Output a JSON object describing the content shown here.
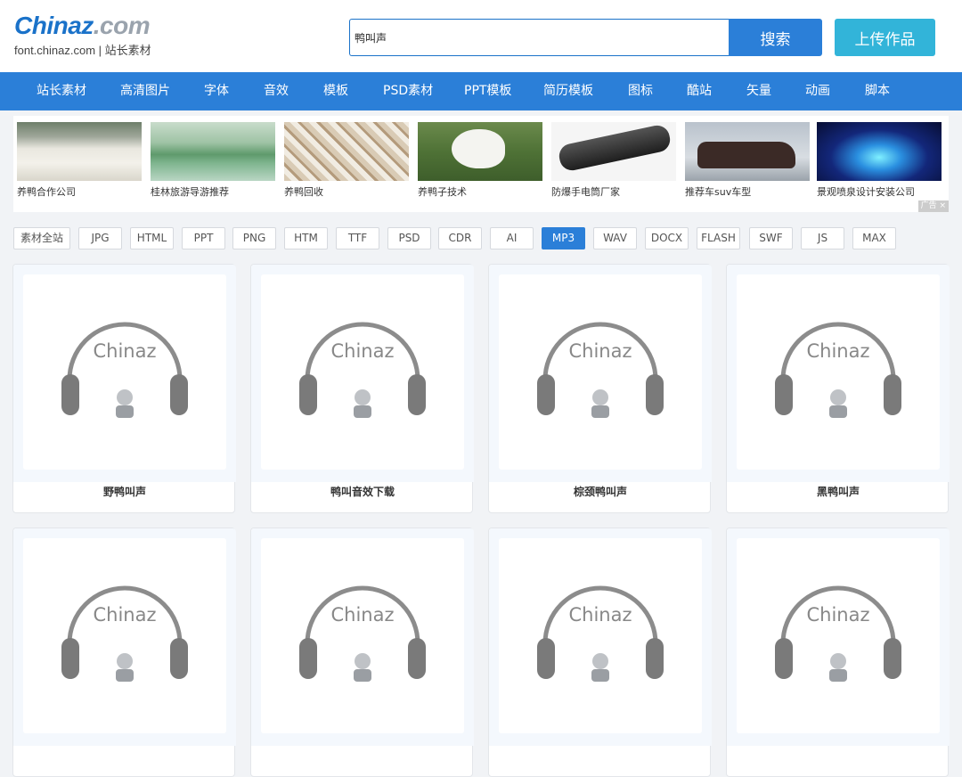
{
  "logo": {
    "main_a": "Chinaz",
    "main_b": ".com",
    "sub": "font.chinaz.com | 站长素材"
  },
  "search": {
    "value": "鸭叫声",
    "button": "搜索"
  },
  "upload_button": "上传作品",
  "nav": [
    "站长素材",
    "高清图片",
    "字体",
    "音效",
    "模板",
    "PSD素材",
    "PPT模板",
    "简历模板",
    "图标",
    "酷站",
    "矢量",
    "动画",
    "脚本"
  ],
  "ads": {
    "items": [
      "养鸭合作公司",
      "桂林旅游导游推荐",
      "养鸭回收",
      "养鸭子技术",
      "防爆手电筒厂家",
      "推荐车suv车型",
      "景观喷泉设计安装公司"
    ],
    "tag": "广告 ×"
  },
  "filters": {
    "items": [
      "素材全站",
      "JPG",
      "HTML",
      "PPT",
      "PNG",
      "HTM",
      "TTF",
      "PSD",
      "CDR",
      "AI",
      "MP3",
      "WAV",
      "DOCX",
      "FLASH",
      "SWF",
      "JS",
      "MAX"
    ],
    "active": "MP3"
  },
  "cards": [
    {
      "title": "野鸭叫声",
      "thumb_text": "Chinaz"
    },
    {
      "title": "鸭叫音效下载",
      "thumb_text": "Chinaz"
    },
    {
      "title": "棕颈鸭叫声",
      "thumb_text": "Chinaz"
    },
    {
      "title": "黑鸭叫声",
      "thumb_text": "Chinaz"
    },
    {
      "title": "",
      "thumb_text": "Chinaz"
    },
    {
      "title": "",
      "thumb_text": "Chinaz"
    },
    {
      "title": "",
      "thumb_text": "Chinaz"
    },
    {
      "title": "",
      "thumb_text": "Chinaz"
    }
  ],
  "colors": {
    "primary": "#2b7fd8",
    "upload": "#32b4d9"
  }
}
